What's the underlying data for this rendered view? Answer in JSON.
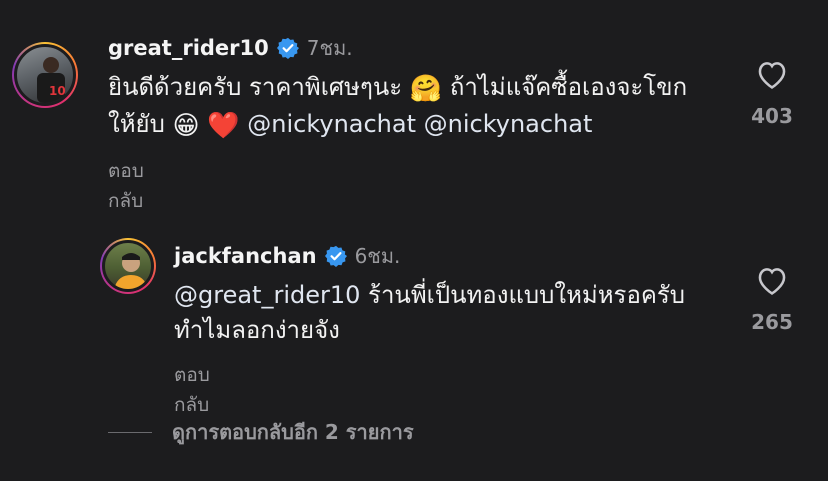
{
  "comments": [
    {
      "username": "great_rider10",
      "time": "7ชม.",
      "text_line1": "ยินดีด้วยครับ ราคาพิเศษๆนะ",
      "emoji1": "🤗",
      "text_line1b": "ถ้าไม่แจ๊คซื้อเองจะโขก",
      "text_line2": "ให้ยับ",
      "emoji2": "😁",
      "emoji3": "❤️",
      "mention": "@nickynachat @nickynachat",
      "reply_label": "ตอบกลับ",
      "likes": "403",
      "verified_icon": "verified-badge-icon",
      "heart_icon": "heart-outline-icon"
    },
    {
      "username": "jackfanchan",
      "time": "6ชม.",
      "mention": "@great_rider10",
      "text_line1": "ร้านพี่เป็นทองแบบใหม่หรอครับ",
      "text_line2": "ทำไมลอกง่ายจัง",
      "reply_label": "ตอบกลับ",
      "likes": "265",
      "verified_icon": "verified-badge-icon",
      "heart_icon": "heart-outline-icon"
    }
  ],
  "view_more_replies": "ดูการตอบกลับอีก 2 รายการ",
  "colors": {
    "background": "#1c1c1e",
    "verified": "#3897f0",
    "muted": "#9a9a9e"
  }
}
